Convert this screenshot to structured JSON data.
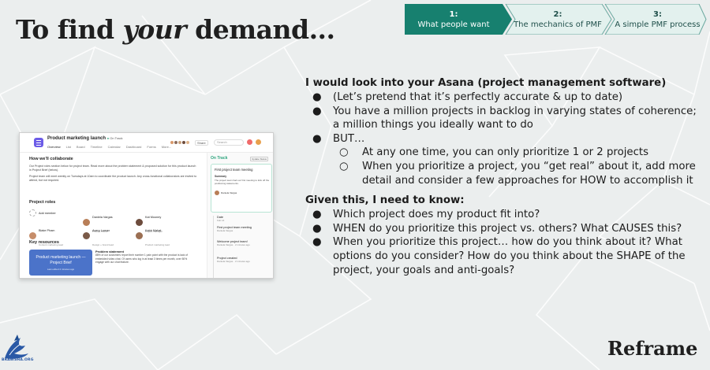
{
  "slide": {
    "title_part1": "To find ",
    "title_emph": "your",
    "title_part2": " demand...",
    "footer_label": "Reframe",
    "logo_text": "BRAWSHA.ORG"
  },
  "process_nav": {
    "steps": [
      {
        "number": "1:",
        "label": "What people want",
        "active": true
      },
      {
        "number": "2:",
        "label": "The mechanics of PMF",
        "active": false
      },
      {
        "number": "3:",
        "label": "A simple PMF process",
        "active": false
      }
    ],
    "active_color": "#17806f",
    "inactive_color": "#e3f1ee"
  },
  "asana": {
    "project_title": "Product marketing launch",
    "status_chip": "On Track",
    "tabs": [
      "Overview",
      "List",
      "Board",
      "Timeline",
      "Calendar",
      "Dashboard",
      "Forms",
      "More..."
    ],
    "share": "Share",
    "search_placeholder": "Search",
    "collab_heading": "How we'll collaborate",
    "collab_text_1": "Our Project roles section below for project team. Read more about the problem statement & proposed solution for this product launch in Project Brief (below).",
    "collab_text_2": "Project team will meet weekly on Tuesdays at 10am to coordinate the product launch. Any cross-functional collaborators are invited to attend, but not required.",
    "roles_heading": "Project roles",
    "roles": [
      {
        "name": "Add member",
        "role": ""
      },
      {
        "name": "Daniela Vargas",
        "role": "Product Owner"
      },
      {
        "name": "Kat Mooney",
        "role": "Project manager"
      },
      {
        "name": "Blake Pham",
        "role": "Content marketing lead"
      },
      {
        "name": "Avery Lomax",
        "role": "Design + brand lead"
      },
      {
        "name": "Kabir Mahat",
        "role": "Product marketing lead"
      }
    ],
    "resources_heading": "Key resources",
    "brief_card": "Product marketing launch — Project Brief",
    "brief_sub": "Last edited 4 minutes ago",
    "problem_heading": "Problem statement",
    "problem_text": "88% of our customers report their number 1 pain point with the product is lack of embedded video chat. Of users who log in at least 3 times per month, over 50% engage with our chat feature.",
    "side_status": "On Track",
    "update_status": "Update Status",
    "status_card_title": "First project team meeting",
    "summary_label": "Summary",
    "summary_text": "The project team had our first meeting to kick off the positioning statements.",
    "card_author": "Daniela Vargas",
    "timeline": [
      {
        "title": "Date",
        "sub": "Feb 14"
      },
      {
        "title": "First project team meeting",
        "sub": "Daniela Vargas"
      },
      {
        "title": "Welcome project team!",
        "sub": "Daniela Vargas · 2 minutes ago"
      },
      {
        "title": "Project created",
        "sub": "Daniela Vargas · 2 minutes ago"
      }
    ]
  },
  "content": {
    "section1_heading": "I would look into your Asana (project management software)",
    "section1": [
      {
        "level": 1,
        "bullet": "●",
        "text": "(Let’s pretend that it’s perfectly accurate & up to date)"
      },
      {
        "level": 1,
        "bullet": "●",
        "text": "You have a million projects in backlog in varying states of coherence; a million things you ideally want to do"
      },
      {
        "level": 1,
        "bullet": "●",
        "text": "BUT…"
      },
      {
        "level": 2,
        "bullet": "○",
        "text": "At any one time, you can only prioritize 1 or 2 projects"
      },
      {
        "level": 2,
        "bullet": "○",
        "text": "When you prioritize a project, you “get real” about it, add more detail and consider a few approaches for HOW to accomplish it"
      }
    ],
    "section2_heading": "Given this, I need to know:",
    "section2": [
      {
        "level": 1,
        "bullet": "●",
        "text": "Which project does my product fit into?"
      },
      {
        "level": 1,
        "bullet": "●",
        "text": "WHEN do you prioritize this project vs. others? What CAUSES this?"
      },
      {
        "level": 1,
        "bullet": "●",
        "text": "When you prioritize this project… how do you think about it? What options do you consider? How do you think about the SHAPE of the project, your goals and anti-goals?"
      }
    ]
  }
}
